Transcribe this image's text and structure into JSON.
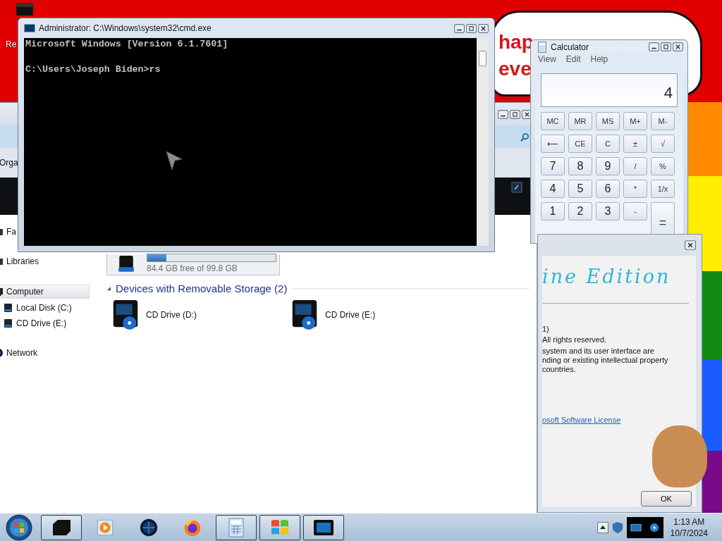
{
  "desktop": {
    "icons": [
      {
        "label": "Re"
      }
    ],
    "wallpaper_text": [
      "hap",
      "eve"
    ]
  },
  "explorer": {
    "toolbar_button": "Orga",
    "nav": [
      {
        "label": "Fa",
        "kind": "favorites",
        "selected": false
      },
      {
        "label": "Libraries",
        "kind": "libraries",
        "selected": false
      },
      {
        "label": "Computer",
        "kind": "computer",
        "selected": true,
        "children": [
          {
            "label": "Local Disk (C:)",
            "selected": false
          },
          {
            "label": "CD Drive (E:)",
            "selected": false
          }
        ]
      },
      {
        "label": "Network",
        "kind": "network",
        "selected": false
      }
    ],
    "drive_tile": {
      "free_text": "84.4 GB free of 99.8 GB",
      "level": 0.15
    },
    "group": {
      "title": "Devices with Removable Storage (2)",
      "expanded": true,
      "items": [
        {
          "label": "CD Drive (D:)"
        },
        {
          "label": "CD Drive (E:)"
        }
      ]
    }
  },
  "cmd": {
    "title": "Administrator: C:\\Windows\\system32\\cmd.exe",
    "banner": "Microsoft Windows [Version 6.1.7601]",
    "prompt": "C:\\Users\\Joseph Biden>rs"
  },
  "calculator": {
    "title": "Calculator",
    "menu": [
      "View",
      "Edit",
      "Help"
    ],
    "display": "4",
    "keys": [
      {
        "label": "MC",
        "kind": "memory"
      },
      {
        "label": "MR",
        "kind": "memory"
      },
      {
        "label": "MS",
        "kind": "memory"
      },
      {
        "label": "M+",
        "kind": "memory"
      },
      {
        "label": "M-",
        "kind": "memory"
      },
      {
        "label": "⟵",
        "kind": "function"
      },
      {
        "label": "CE",
        "kind": "function"
      },
      {
        "label": "C",
        "kind": "function"
      },
      {
        "label": "±",
        "kind": "function"
      },
      {
        "label": "√",
        "kind": "function"
      },
      {
        "label": "7",
        "kind": "digit"
      },
      {
        "label": "8",
        "kind": "digit"
      },
      {
        "label": "9",
        "kind": "digit"
      },
      {
        "label": "/",
        "kind": "function"
      },
      {
        "label": "%",
        "kind": "function"
      },
      {
        "label": "4",
        "kind": "digit"
      },
      {
        "label": "5",
        "kind": "digit"
      },
      {
        "label": "6",
        "kind": "digit"
      },
      {
        "label": "*",
        "kind": "function"
      },
      {
        "label": "1/x",
        "kind": "function"
      },
      {
        "label": "1",
        "kind": "digit"
      },
      {
        "label": "2",
        "kind": "digit"
      },
      {
        "label": "3",
        "kind": "digit"
      },
      {
        "label": "-",
        "kind": "function"
      },
      {
        "label": "=",
        "kind": "equals"
      }
    ]
  },
  "about": {
    "heading": "ine Edition",
    "version_line": "1)",
    "rights": "All rights reserved.",
    "notice": [
      "system and its user interface are",
      "nding or existing intellectual property",
      "countries."
    ],
    "license_link": "osoft Software License",
    "ok_button": "OK"
  },
  "taskbar": {
    "buttons": [
      {
        "kind": "box",
        "active": true
      },
      {
        "kind": "media",
        "active": false
      },
      {
        "kind": "globe",
        "active": false
      },
      {
        "kind": "firefox",
        "active": false
      },
      {
        "kind": "calculator",
        "active": true
      },
      {
        "kind": "windows",
        "active": true
      },
      {
        "kind": "monitor",
        "active": true
      }
    ],
    "time": "1:13 AM",
    "date": "10/7/2024"
  }
}
